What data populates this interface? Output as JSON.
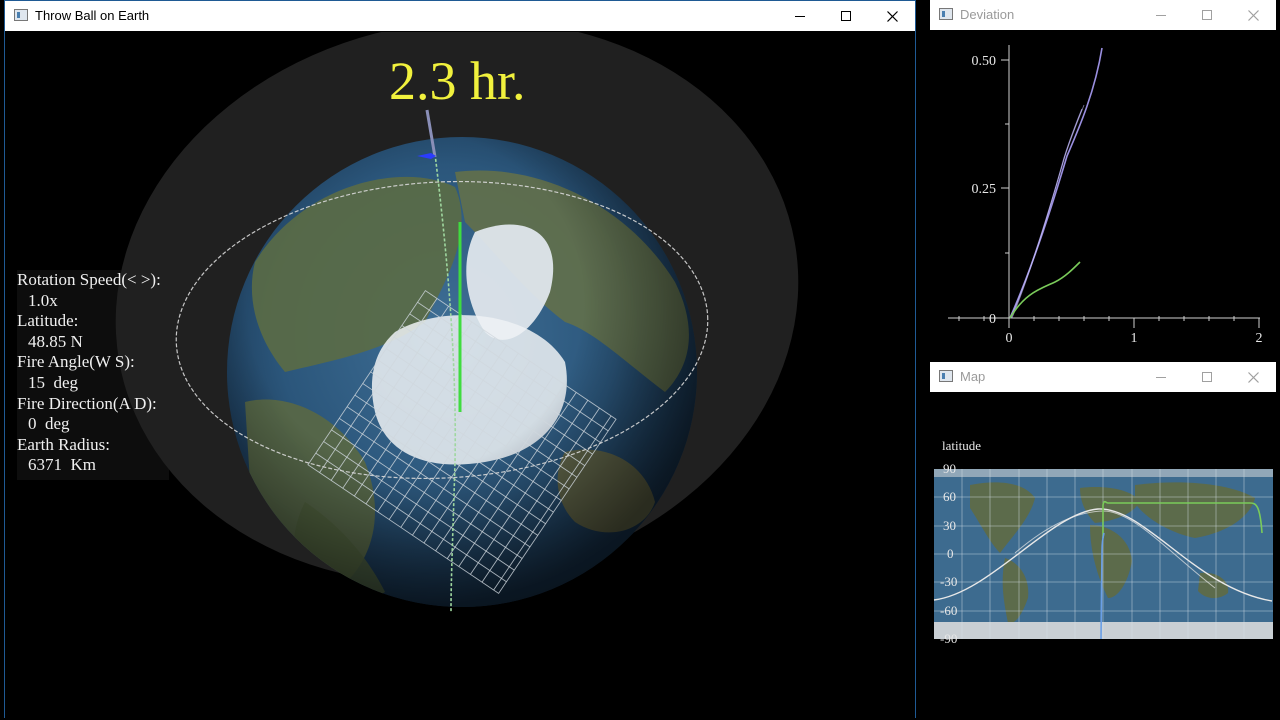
{
  "main_window": {
    "title": "Throw Ball on Earth",
    "elapsed_time": "2.3 hr.",
    "settings": [
      {
        "label": "Rotation Speed(< >):",
        "value": "1.0x"
      },
      {
        "label": "Latitude:",
        "value": "48.85 N"
      },
      {
        "label": "Fire Angle(W S):",
        "value": "15  deg"
      },
      {
        "label": "Fire Direction(A D):",
        "value": "0  deg"
      },
      {
        "label": "Earth Radius:",
        "value": "6371  Km"
      }
    ]
  },
  "deviation_window": {
    "title": "Deviation",
    "x_ticks": [
      "0",
      "1",
      "2"
    ],
    "y_ticks": [
      "0",
      "0.25",
      "0.50"
    ]
  },
  "map_window": {
    "title": "Map",
    "axis_label": "latitude",
    "lat_ticks": [
      "90",
      "60",
      "30",
      "0",
      "-30",
      "-60",
      "-90"
    ]
  },
  "colors": {
    "time_text": "#f1f13d",
    "trajectory_green": "#3fdc3f",
    "deviation_purple": "#9a8fe0",
    "deviation_green": "#7acb5a",
    "map_blue": "#6a9fe6",
    "map_white": "#e8e8e8",
    "window_border": "#1f5a94"
  },
  "icons": [
    "app-window-icon",
    "minimize-icon",
    "maximize-icon",
    "close-icon"
  ]
}
